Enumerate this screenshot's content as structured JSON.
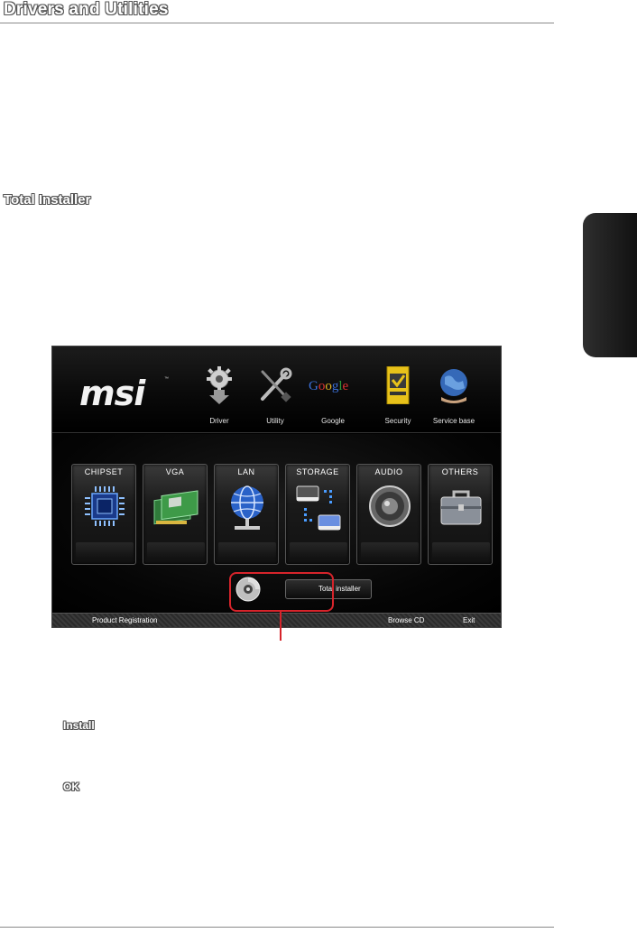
{
  "page": {
    "title": "Drivers and Utilities",
    "section_heading": "Total Installer",
    "steps": [
      "Install",
      "OK"
    ]
  },
  "app": {
    "brand": "msi",
    "top_items": [
      {
        "label": "Driver",
        "icon": "gear-download-icon"
      },
      {
        "label": "Utility",
        "icon": "wrench-screwdriver-icon"
      },
      {
        "label": "Google",
        "icon": "google-logo-icon"
      },
      {
        "label": "Security",
        "icon": "norton-shield-icon"
      },
      {
        "label": "Service base",
        "icon": "globe-hand-icon"
      }
    ],
    "categories": [
      {
        "label": "CHIPSET",
        "icon": "chip-icon"
      },
      {
        "label": "VGA",
        "icon": "graphics-card-icon"
      },
      {
        "label": "LAN",
        "icon": "network-globe-icon"
      },
      {
        "label": "STORAGE",
        "icon": "storage-drives-icon"
      },
      {
        "label": "AUDIO",
        "icon": "speaker-icon"
      },
      {
        "label": "OTHERS",
        "icon": "toolbox-icon"
      }
    ],
    "total_installer_label": "Total installer",
    "footer": {
      "product_registration": "Product Registration",
      "browse_cd": "Browse CD",
      "exit": "Exit"
    }
  },
  "colors": {
    "highlight": "#d6242b",
    "side_tab": "#1a1a1a"
  }
}
